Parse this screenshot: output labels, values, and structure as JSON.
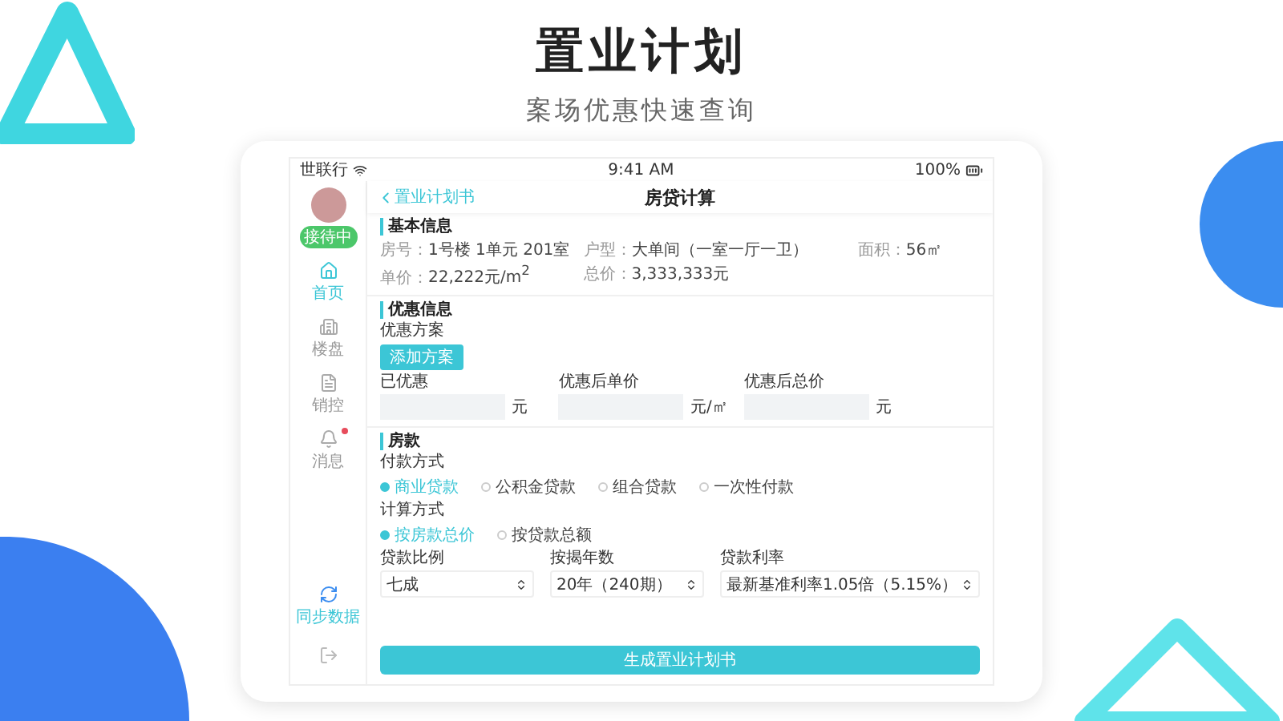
{
  "header": {
    "title": "置业计划",
    "subtitle": "案场优惠快速查询"
  },
  "status_bar": {
    "carrier": "世联行",
    "time": "9:41 AM",
    "battery": "100%"
  },
  "sidebar": {
    "user_badge": "接待中",
    "items": [
      {
        "label": "首页",
        "selected": true,
        "unread": false
      },
      {
        "label": "楼盘",
        "selected": false,
        "unread": false
      },
      {
        "label": "销控",
        "selected": false,
        "unread": false
      },
      {
        "label": "消息",
        "selected": false,
        "unread": true
      }
    ],
    "sync_label": "同步数据"
  },
  "nav": {
    "back": "置业计划书",
    "title": "房贷计算"
  },
  "basic_info": {
    "title": "基本信息",
    "fields": [
      {
        "label": "房号：",
        "value": "1号楼  1单元  201室"
      },
      {
        "label": "户型：",
        "value": "大单间（一室一厅一卫）"
      },
      {
        "label": "面积：",
        "value": "56㎡"
      },
      {
        "label": "单价：",
        "value": "22,222元/m$^{2}$"
      },
      {
        "label": "总价：",
        "value": "3,333,333元"
      }
    ]
  },
  "discount": {
    "title": "优惠信息",
    "plan_label": "优惠方案",
    "add_button": "添加方案",
    "fields": [
      {
        "label": "已优惠",
        "unit": "元"
      },
      {
        "label": "优惠后单价",
        "unit": "元/㎡"
      },
      {
        "label": "优惠后总价",
        "unit": "元"
      }
    ]
  },
  "loan": {
    "title": "房款",
    "payment_label": "付款方式",
    "payment_options": [
      {
        "label": "商业贷款",
        "selected": true
      },
      {
        "label": "公积金贷款",
        "selected": false
      },
      {
        "label": "组合贷款",
        "selected": false
      },
      {
        "label": "一次性付款",
        "selected": false
      }
    ],
    "calc_label": "计算方式",
    "calc_options": [
      {
        "label": "按房款总价",
        "selected": true
      },
      {
        "label": "按贷款总额",
        "selected": false
      }
    ],
    "selects": [
      {
        "label": "贷款比例",
        "value": "七成"
      },
      {
        "label": "按揭年数",
        "value": "20年（240期）"
      },
      {
        "label": "贷款利率",
        "value": "最新基准利率1.05倍（5.15%）"
      }
    ]
  },
  "submit_button": "生成置业计划书"
}
